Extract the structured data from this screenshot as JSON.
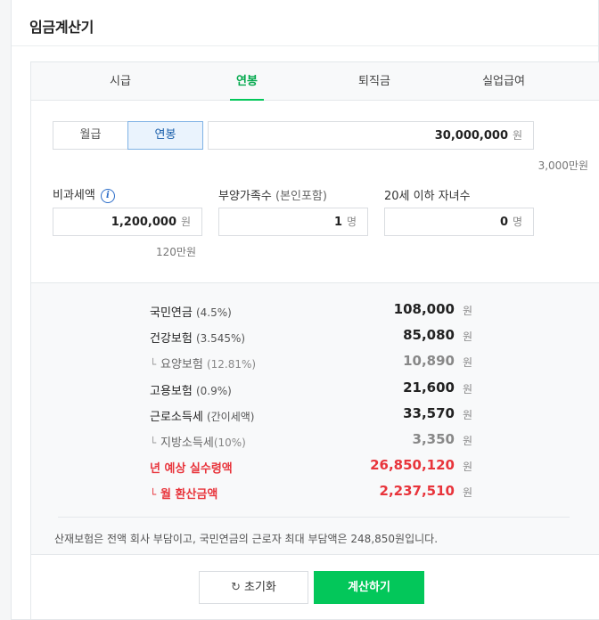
{
  "title": "임금계산기",
  "tabs": [
    {
      "label": "시급",
      "active": false
    },
    {
      "label": "연봉",
      "active": true
    },
    {
      "label": "퇴직금",
      "active": false
    },
    {
      "label": "실업급여",
      "active": false
    }
  ],
  "pay_type": {
    "options": [
      "월급",
      "연봉"
    ],
    "selected": "연봉"
  },
  "salary": {
    "value": "30,000,000",
    "unit": "원",
    "hint": "3,000만원"
  },
  "nontax": {
    "label": "비과세액",
    "value": "1,200,000",
    "unit": "원",
    "hint": "120만원"
  },
  "dependents": {
    "label": "부양가족수",
    "label_sub": "(본인포함)",
    "value": "1",
    "unit": "명"
  },
  "children": {
    "label": "20세 이하 자녀수",
    "value": "0",
    "unit": "명"
  },
  "results": [
    {
      "name": "국민연금",
      "pct": "(4.5%)",
      "amount": "108,000",
      "unit": "원"
    },
    {
      "name": "건강보험",
      "pct": "(3.545%)",
      "amount": "85,080",
      "unit": "원"
    },
    {
      "name": "요양보험",
      "pct": "(12.81%)",
      "amount": "10,890",
      "unit": "원"
    },
    {
      "name": "고용보험",
      "pct": "(0.9%)",
      "amount": "21,600",
      "unit": "원"
    },
    {
      "name": "근로소득세",
      "pct": "(간이세액)",
      "amount": "33,570",
      "unit": "원"
    },
    {
      "name": "지방소득세",
      "pct": "(10%)",
      "amount": "3,350",
      "unit": "원"
    },
    {
      "name": "년 예상 실수령액",
      "amount": "26,850,120",
      "unit": "원"
    },
    {
      "name": "월 환산금액",
      "amount": "2,237,510",
      "unit": "원"
    }
  ],
  "note": "산재보험은 전액 회사 부담이고, 국민연금의 근로자 최대 부담액은 248,850원입니다.",
  "buttons": {
    "reset": "초기화",
    "calculate": "계산하기"
  },
  "colors": {
    "accent": "#03c75a",
    "highlight": "#e8343b",
    "toggle": "#1a5fab"
  }
}
